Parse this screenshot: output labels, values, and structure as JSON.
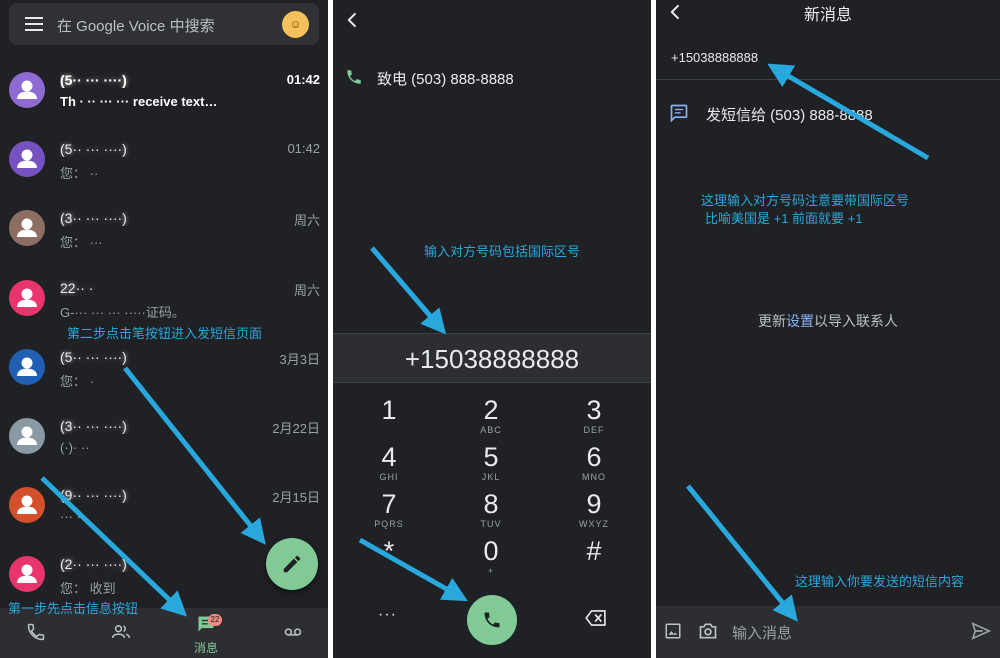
{
  "panel1": {
    "search_placeholder": "在 Google Voice 中搜索",
    "conversations": [
      {
        "name": "(5·· ··· ····)",
        "time": "01:42",
        "snippet": "Th · ·· ··· ··· receive text…",
        "unread": true,
        "avatar_color": "#8e6bd2"
      },
      {
        "name": "(5·· ··· ····)",
        "time": "01:42",
        "snippet": "您： ··",
        "unread": false,
        "avatar_color": "#7651c0"
      },
      {
        "name": "(3·· ··· ····)",
        "time": "周六",
        "snippet": "您： ···",
        "unread": false,
        "avatar_color": "#8d6e63"
      },
      {
        "name": "22·· ·",
        "time": "周六",
        "snippet": "G-··· ··· ··· ·····证码。",
        "unread": false,
        "avatar_color": "#e8366c"
      },
      {
        "name": "(5·· ··· ····)",
        "time": "3月3日",
        "snippet": "您： ·",
        "unread": false,
        "avatar_color": "#1f5fb4"
      },
      {
        "name": "(3·· ··· ····)",
        "time": "2月22日",
        "snippet": "(·)· ··",
        "unread": false,
        "avatar_color": "#8a9aa5"
      },
      {
        "name": "(9·· ··· ····)",
        "time": "2月15日",
        "snippet": "··· ··",
        "unread": false,
        "avatar_color": "#d4502a"
      },
      {
        "name": "(2·· ··· ····)",
        "time": "",
        "snippet": "您：  收到",
        "unread": false,
        "avatar_color": "#e8366c"
      }
    ],
    "nav": {
      "messages_label": "消息",
      "badge": "22"
    },
    "annotation_step1": "第一步先点击信息按钮",
    "annotation_step2": "第二步点击笔按钮进入发短信页面"
  },
  "panel2": {
    "call_row": "致电 (503) 888-8888",
    "number": "+15038888888",
    "keys": [
      {
        "d": "1",
        "l": ""
      },
      {
        "d": "2",
        "l": "ABC"
      },
      {
        "d": "3",
        "l": "DEF"
      },
      {
        "d": "4",
        "l": "GHI"
      },
      {
        "d": "5",
        "l": "JKL"
      },
      {
        "d": "6",
        "l": "MNO"
      },
      {
        "d": "7",
        "l": "PQRS"
      },
      {
        "d": "8",
        "l": "TUV"
      },
      {
        "d": "9",
        "l": "WXYZ"
      },
      {
        "d": "*",
        "l": ""
      },
      {
        "d": "0",
        "l": "+"
      },
      {
        "d": "#",
        "l": ""
      }
    ],
    "more_label": "···",
    "annotation": "输入对方号码包括国际区号"
  },
  "panel3": {
    "title": "新消息",
    "to_value": "+15038888888",
    "sms_row": "发短信给 (503) 888-8888",
    "note_prefix": "更新",
    "note_link": "设置",
    "note_suffix": "以导入联系人",
    "message_placeholder": "输入消息",
    "annotation_line1": "这理输入对方号码注意要带国际区号",
    "annotation_line2": "比喻美国是 +1 前面就要 +1",
    "annotation_compose": "这理输入你要发送的短信内容"
  },
  "colors": {
    "accent": "#81c995",
    "annotation": "#29a8dd",
    "background": "#202124"
  }
}
